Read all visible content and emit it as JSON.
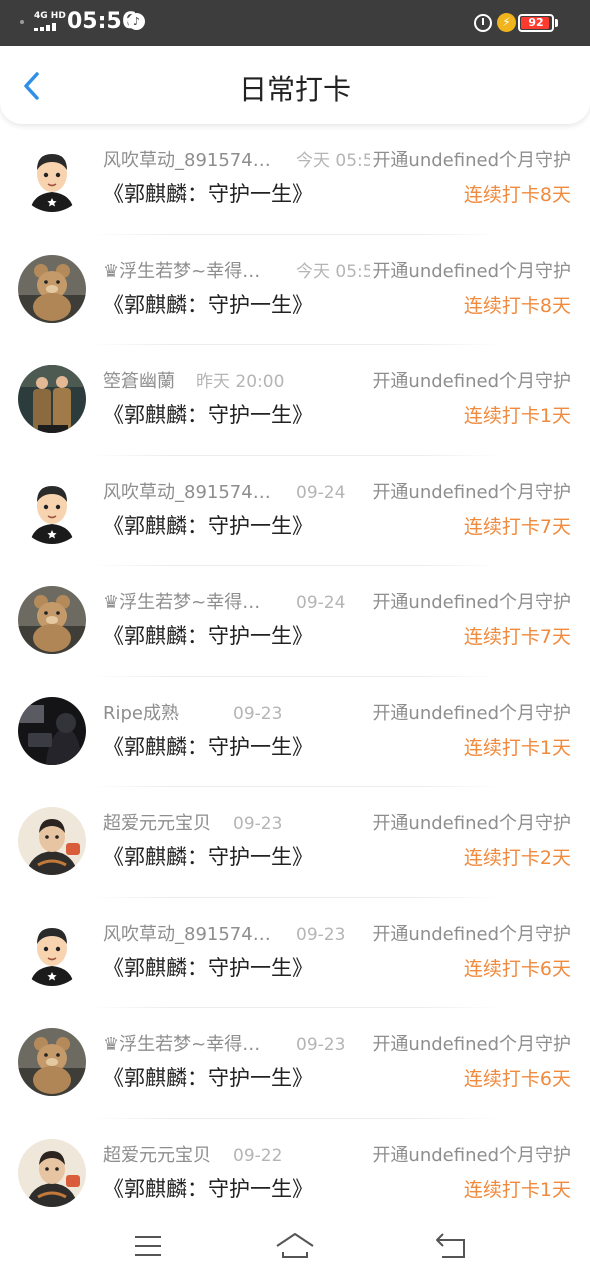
{
  "status_bar": {
    "network": "4G HD",
    "time": "05:56",
    "battery": "92",
    "battery_level": 0.92,
    "battery_color": "#ff3b30",
    "charging_color": "#f0b41d"
  },
  "header": {
    "title": "日常打卡",
    "back_icon": "chevron-left-icon",
    "accent_color": "#2f8fe6"
  },
  "checkins": [
    {
      "name": "风吹草动_891574…",
      "time": "今天 05:57",
      "guard": "开通undefined个月守护",
      "content": "《郭麒麟：守护一生》",
      "streak": "连续打卡8天",
      "avatar": "cartoon"
    },
    {
      "name": "♛浮生若梦~幸得…",
      "time": "今天 05:57",
      "guard": "开通undefined个月守护",
      "content": "《郭麒麟：守护一生》",
      "streak": "连续打卡8天",
      "avatar": "bear"
    },
    {
      "name": "箜篬幽蘭",
      "time": "昨天 20:00",
      "guard": "开通undefined个月守护",
      "content": "《郭麒麟：守护一生》",
      "streak": "连续打卡1天",
      "avatar": "duo"
    },
    {
      "name": "风吹草动_891574…",
      "time": "09-24",
      "guard": "开通undefined个月守护",
      "content": "《郭麒麟：守护一生》",
      "streak": "连续打卡7天",
      "avatar": "cartoon"
    },
    {
      "name": "♛浮生若梦~幸得…",
      "time": "09-24",
      "guard": "开通undefined个月守护",
      "content": "《郭麒麟：守护一生》",
      "streak": "连续打卡7天",
      "avatar": "bear"
    },
    {
      "name": "Ripe成熟",
      "time": "09-23",
      "guard": "开通undefined个月守护",
      "content": "《郭麒麟：守护一生》",
      "streak": "连续打卡1天",
      "avatar": "dark"
    },
    {
      "name": "超爱元元宝贝",
      "time": "09-23",
      "guard": "开通undefined个月守护",
      "content": "《郭麒麟：守护一生》",
      "streak": "连续打卡2天",
      "avatar": "photo"
    },
    {
      "name": "风吹草动_891574…",
      "time": "09-23",
      "guard": "开通undefined个月守护",
      "content": "《郭麒麟：守护一生》",
      "streak": "连续打卡6天",
      "avatar": "cartoon"
    },
    {
      "name": "♛浮生若梦~幸得…",
      "time": "09-23",
      "guard": "开通undefined个月守护",
      "content": "《郭麒麟：守护一生》",
      "streak": "连续打卡6天",
      "avatar": "bear"
    },
    {
      "name": "超爱元元宝贝",
      "time": "09-22",
      "guard": "开通undefined个月守护",
      "content": "《郭麒麟：守护一生》",
      "streak": "连续打卡1天",
      "avatar": "photo"
    }
  ],
  "colors": {
    "streak": "#f08a3e",
    "name": "#8e8e8e",
    "time": "#b5b5b5",
    "content": "#222222"
  },
  "bottom_nav": {
    "menu_icon": "menu-icon",
    "home_icon": "home-icon",
    "back_icon": "return-icon"
  }
}
